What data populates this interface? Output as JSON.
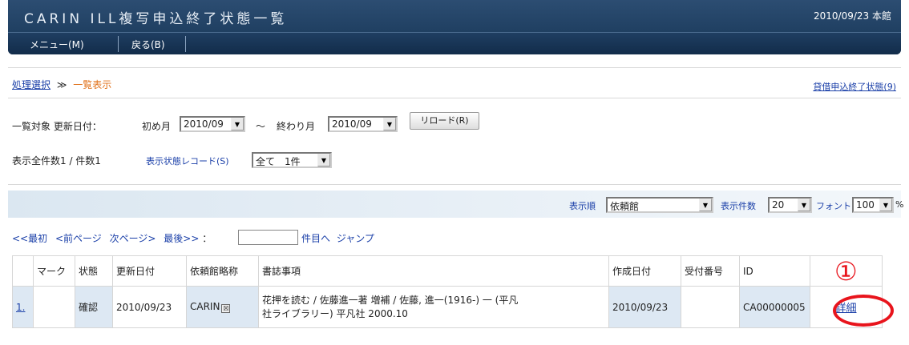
{
  "header": {
    "title": "CARIN ILL複写申込終了状態一覧",
    "date_library": "2010/09/23 本館",
    "menu": [
      {
        "label": "メニュー(M)"
      },
      {
        "label": "戻る(B)"
      }
    ]
  },
  "breadcrumb": {
    "link": "処理選択",
    "separator": "≫",
    "current": "一覧表示",
    "right_link": "貸借申込終了状態(9)"
  },
  "filter": {
    "label": "一覧対象 更新日付：",
    "start_label": "初め月",
    "start_value": "2010/09",
    "tilde": "～",
    "end_label": "終わり月",
    "end_value": "2010/09",
    "reload_label": "リロード(R)"
  },
  "counts": {
    "text": "表示全件数1 / 件数1",
    "status_label": "表示状態レコード(S)",
    "status_value": "全て　1件"
  },
  "sortbar": {
    "order_label": "表示順",
    "order_value": "依頼館",
    "count_label": "表示件数",
    "count_value": "20",
    "font_label": "フォント",
    "font_value": "100",
    "percent": "%"
  },
  "pager": {
    "first": "<<最初",
    "prev": "<前ページ",
    "next": "次ページ>",
    "last": "最後>>",
    "colon": "：",
    "suffix": "件目へ",
    "jump": "ジャンプ"
  },
  "table": {
    "headers": [
      "",
      "マーク",
      "状態",
      "更新日付",
      "依頼館略称",
      "書誌事項",
      "作成日付",
      "受付番号",
      "ID",
      ""
    ],
    "rows": [
      {
        "no": "1.",
        "mark": "",
        "status": "確認",
        "updated": "2010/09/23",
        "library": "CARIN",
        "biblio_line1": "花押を読む / 佐藤進一著 増補 / 佐藤, 進一(1916-) 一 (平凡",
        "biblio_line2": "社ライブラリー) 平凡社 2000.10",
        "created": "2010/09/23",
        "receipt": "",
        "id": "CA00000005",
        "action": "詳細"
      }
    ]
  },
  "annotation": {
    "number": "①"
  },
  "colors": {
    "header_bg": "#1d3d60",
    "link": "#1a3fa8",
    "current_crumb": "#e07018",
    "annotation_red": "#e8141c",
    "row_blue": "#dde8f3"
  }
}
